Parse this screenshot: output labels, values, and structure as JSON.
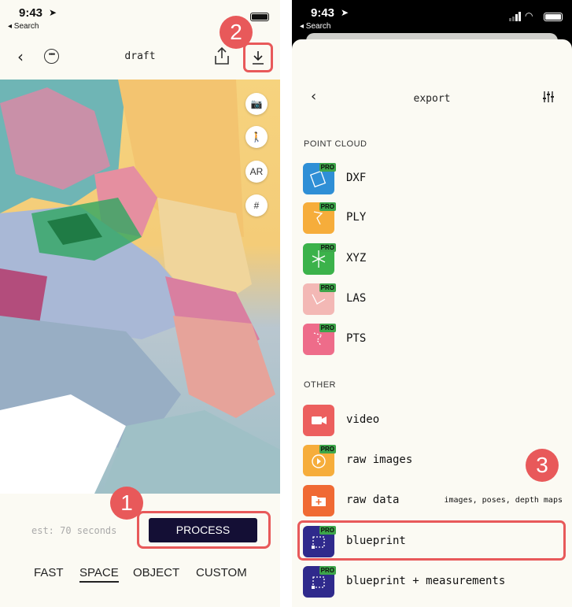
{
  "left": {
    "status": {
      "time": "9:43",
      "back_app": "◂ Search"
    },
    "nav": {
      "title": "draft"
    },
    "tools": {
      "ar_label": "AR"
    },
    "bottom": {
      "estimate": "est: 70 seconds",
      "process_label": "PROCESS",
      "modes": [
        "FAST",
        "SPACE",
        "OBJECT",
        "CUSTOM"
      ],
      "active_mode": "SPACE"
    },
    "badges": {
      "process_step": "1",
      "download_step": "2"
    }
  },
  "right": {
    "status": {
      "time": "9:43",
      "back_app": "◂ Search"
    },
    "nav": {
      "title": "export"
    },
    "sections": {
      "point_cloud": "POINT CLOUD",
      "other": "OTHER"
    },
    "pro_tag": "PRO",
    "items": [
      {
        "label": "DXF",
        "color": "#2f8fd6",
        "icon": "dxf-icon",
        "pro": true
      },
      {
        "label": "PLY",
        "color": "#f6ad3b",
        "icon": "ply-icon",
        "pro": true
      },
      {
        "label": "XYZ",
        "color": "#3bb24a",
        "icon": "xyz-icon",
        "pro": true
      },
      {
        "label": "LAS",
        "color": "#f3b8b5",
        "icon": "las-icon",
        "pro": true
      },
      {
        "label": "PTS",
        "color": "#ee6c8a",
        "icon": "pts-icon",
        "pro": true
      },
      {
        "label": "video",
        "color": "#ec5f5e",
        "icon": "video-camera-icon",
        "pro": false
      },
      {
        "label": "raw images",
        "color": "#f6ad3b",
        "icon": "timer-icon",
        "pro": true
      },
      {
        "label": "raw data",
        "sub": "images, poses, depth maps",
        "color": "#f06a34",
        "icon": "folder-plus-icon",
        "pro": false
      },
      {
        "label": "blueprint",
        "color": "#2f2a8c",
        "icon": "blueprint-icon",
        "pro": true
      },
      {
        "label": "blueprint + measurements",
        "color": "#2f2a8c",
        "icon": "blueprint-icon",
        "pro": true
      }
    ],
    "badges": {
      "raw_data_step": "3"
    }
  }
}
